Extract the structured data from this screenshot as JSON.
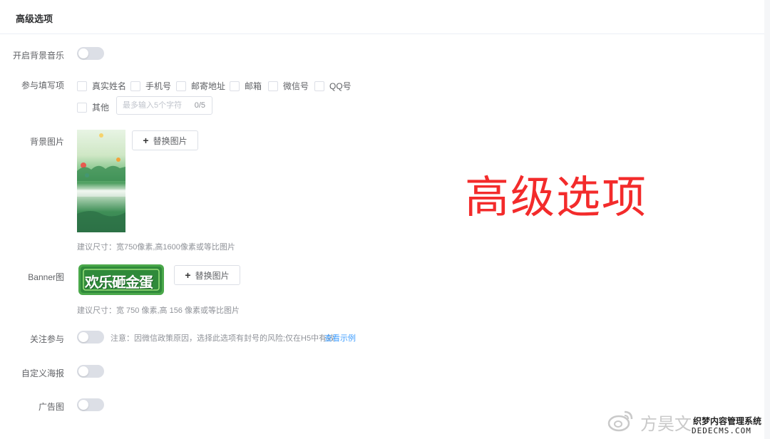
{
  "section_title": "高级选项",
  "rows": {
    "bgm": {
      "label": "开启背景音乐",
      "enabled": false
    },
    "fields": {
      "label": "参与填写项",
      "options": [
        "真实姓名",
        "手机号",
        "邮寄地址",
        "邮箱",
        "微信号",
        "QQ号",
        "其他"
      ],
      "other_input": {
        "placeholder": "最多输入5个字符",
        "value": "",
        "count": "0/5"
      }
    },
    "bg_image": {
      "label": "背景图片",
      "replace_button": "替换图片",
      "hint": "建议尺寸：宽750像素,高1600像素或等比图片"
    },
    "banner": {
      "label": "Banner图",
      "banner_text": "欢乐砸金蛋",
      "replace_button": "替换图片",
      "hint": "建议尺寸：宽 750 像素,高 156 像素或等比图片"
    },
    "follow": {
      "label": "关注参与",
      "enabled": false,
      "note": "注意：因微信政策原因，选择此选项有封号的风险;仅在H5中有效",
      "link": "查看示例"
    },
    "poster": {
      "label": "自定义海报",
      "enabled": false
    },
    "ad": {
      "label": "广告图",
      "enabled": false
    }
  },
  "overlay_title": "高级选项",
  "watermark": {
    "text": "方昊文",
    "brand": "织梦内容管理系统",
    "domain": "DEDECMS.COM"
  },
  "colors": {
    "switch_off": "#dcdfe6",
    "link": "#409eff",
    "overlay_title": "#f32b2b"
  }
}
